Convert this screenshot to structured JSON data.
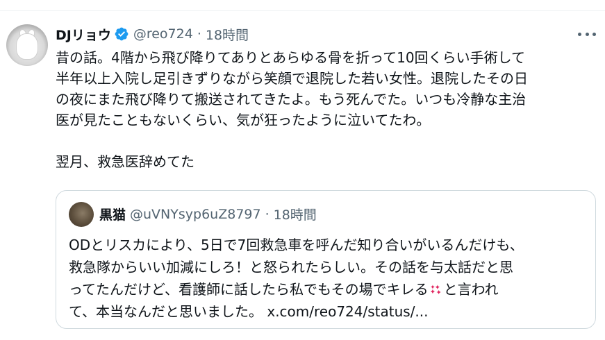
{
  "tweet": {
    "author_name": "DJリョウ",
    "handle": "@reo724",
    "separator": "·",
    "time": "18時間",
    "text": "昔の話。4階から飛び降りてありとあらゆる骨を折って10回くらい手術して\n半年以上入院し足引きずりながら笑顔で退院した若い女性。退院したその日\nの夜にまた飛び降りて搬送されてきたよ。もう死んでた。いつも冷静な主治\n医が見たこともないくらい、気が狂ったように泣いてたわ。\n\n翌月、救急医辞めてた",
    "verified_icon": "verified-badge-icon",
    "more_icon": "more-horizontal-icon"
  },
  "quote": {
    "author_name": "黒猫",
    "handle": "@uVNYsyp6uZ8797",
    "separator": "·",
    "time": "18時間",
    "text_before_emoji": "ODとリスカにより、5日で7回救急車を呼んだ知り合いがいるんだけも、\n救急隊からいい加減にしろ！と怒られたらしい。その話を与太話だと思\nってたんだけど、看護師に話したら私でもその場でキレる",
    "emoji_icon": "anger-symbol-icon",
    "text_after_emoji": "と言われ\nて、本当なんだと思いました。 ",
    "link": "x.com/reo724/status/..."
  },
  "colors": {
    "text": "#0f1419",
    "secondary": "#536471",
    "verified": "#1d9bf0",
    "border": "#cfd9de"
  }
}
